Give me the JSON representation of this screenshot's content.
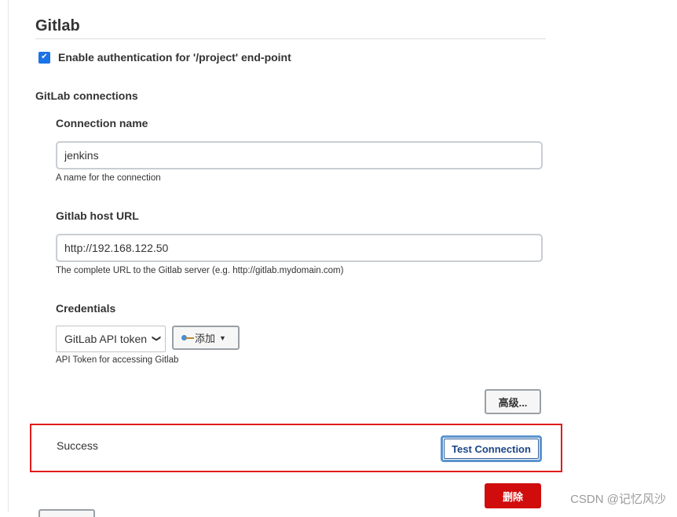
{
  "section": {
    "title": "Gitlab"
  },
  "auth": {
    "checkbox_label": "Enable authentication for '/project' end-point",
    "checked": true
  },
  "connections": {
    "title": "GitLab connections",
    "name": {
      "label": "Connection name",
      "value": "jenkins",
      "help": "A name for the connection"
    },
    "host": {
      "label": "Gitlab host URL",
      "value": "http://192.168.122.50",
      "help": "The complete URL to the Gitlab server (e.g. http://gitlab.mydomain.com)"
    },
    "credentials": {
      "label": "Credentials",
      "selected": "GitLab API token",
      "add_label": "添加",
      "help": "API Token for accessing Gitlab"
    },
    "advanced_label": "高级...",
    "status": "Success",
    "test_label": "Test Connection",
    "delete_label": "删除"
  },
  "watermark": "CSDN @记忆风沙",
  "colors": {
    "accent": "#1a73e8",
    "danger": "#d00c0c",
    "highlight": "#e01b1b"
  }
}
